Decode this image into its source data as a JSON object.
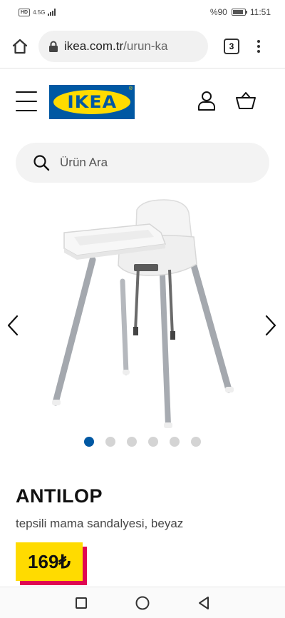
{
  "status_bar": {
    "network_badge": "HD",
    "network_type": "4.5G",
    "battery_percent": "%90",
    "battery_level": 0.9,
    "time": "11:51"
  },
  "browser": {
    "url_domain": "ikea.com.tr",
    "url_path": "/urun-ka",
    "tab_count": "3"
  },
  "site": {
    "logo_text": "IKEA",
    "logo_mark": "®",
    "search_placeholder": "Ürün Ara",
    "brand_colors": {
      "blue": "#0058a3",
      "yellow": "#ffdb00",
      "red": "#e00751"
    }
  },
  "gallery": {
    "image_count": 6,
    "active_index": 0
  },
  "product": {
    "name": "ANTILOP",
    "description": "tepsili mama sandalyesi, beyaz",
    "price": "169₺"
  }
}
